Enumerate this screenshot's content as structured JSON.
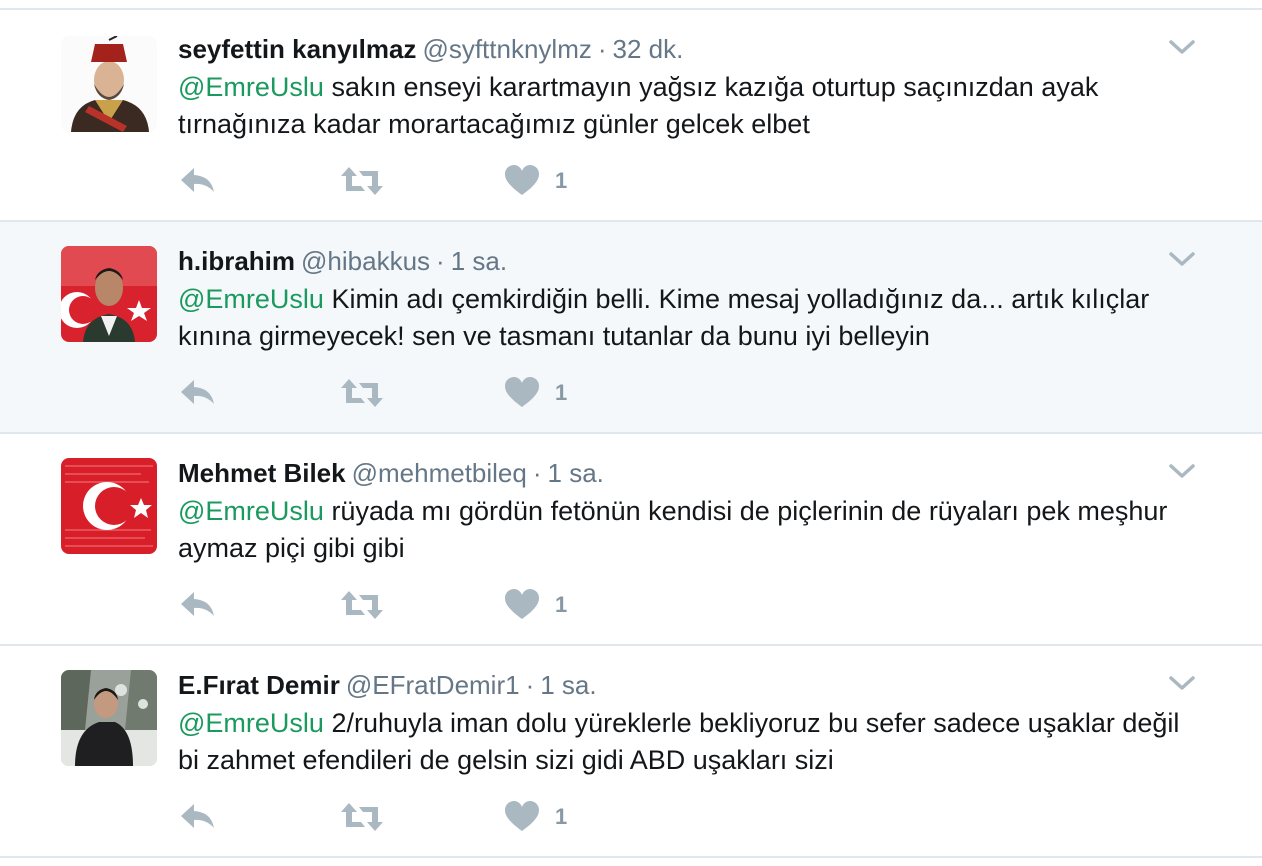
{
  "colors": {
    "mention": "#1b9a5f",
    "secondary_text": "#657786",
    "action_icon": "#aab8c2",
    "highlight_bg": "#f5f8fa",
    "divider": "#e1e8ed"
  },
  "icons": {
    "reply": "reply-icon",
    "retweet": "retweet-icon",
    "like": "heart-icon",
    "menu": "chevron-down-icon"
  },
  "tweets": [
    {
      "name": "seyfettin kanyılmaz",
      "handle": "@syfttnknylmz",
      "separator": "·",
      "time": "32 dk.",
      "mention": "@EmreUslu",
      "text": " sakın enseyi karartmayın yağsız kazığa oturtup saçınızdan ayak tırnağınıza kadar morartacağımız günler gelcek elbet",
      "likes": "1"
    },
    {
      "name": "h.ibrahim",
      "handle": "@hibakkus",
      "separator": "·",
      "time": "1 sa.",
      "mention": "@EmreUslu",
      "text": " Kimin adı çemkirdiğin belli. Kime mesaj yolladığınız da... artık kılıçlar kınına girmeyecek! sen ve tasmanı tutanlar da bunu iyi belleyin",
      "likes": "1"
    },
    {
      "name": "Mehmet Bilek",
      "handle": "@mehmetbileq",
      "separator": "·",
      "time": "1 sa.",
      "mention": "@EmreUslu",
      "text": " rüyada mı gördün fetönün kendisi de piçlerinin de rüyaları pek meşhur aymaz piçi gibi gibi",
      "likes": "1"
    },
    {
      "name": "E.Fırat Demir",
      "handle": "@EFratDemir1",
      "separator": "·",
      "time": "1 sa.",
      "mention": "@EmreUslu",
      "text": " 2/ruhuyla iman dolu yüreklerle bekliyoruz bu sefer sadece uşaklar değil bi zahmet efendileri de gelsin sizi gidi ABD uşakları sizi",
      "likes": "1"
    }
  ]
}
